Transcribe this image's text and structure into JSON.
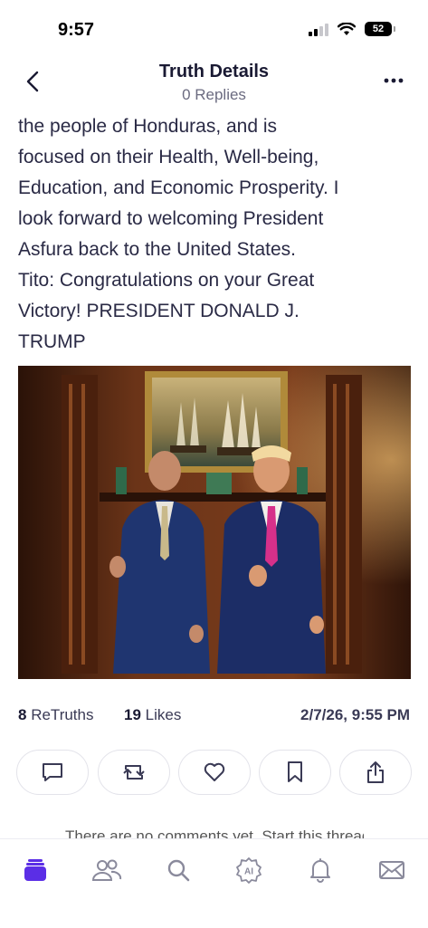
{
  "status": {
    "time": "9:57",
    "battery": "52"
  },
  "header": {
    "title": "Truth Details",
    "subtitle": "0 Replies"
  },
  "post": {
    "lines": [
      "the people of Honduras, and is",
      "focused on their Health, Well-being,",
      "Education, and Economic Prosperity. I",
      "look forward to welcoming President",
      "Asfura back to the United States.",
      "Tito: Congratulations on your Great",
      "Victory! PRESIDENT DONALD J.",
      "TRUMP"
    ]
  },
  "stats": {
    "retruths_count": "8",
    "retruths_label": "ReTruths",
    "likes_count": "19",
    "likes_label": "Likes",
    "date": "2/7/26, 9:55 PM"
  },
  "peek_text": "There are no comments yet. Start this thread",
  "tabs": [
    "home",
    "groups",
    "search",
    "ai",
    "notifications",
    "messages"
  ],
  "colors": {
    "accent": "#5b2ee6",
    "icon_gray": "#8a8a9c"
  }
}
